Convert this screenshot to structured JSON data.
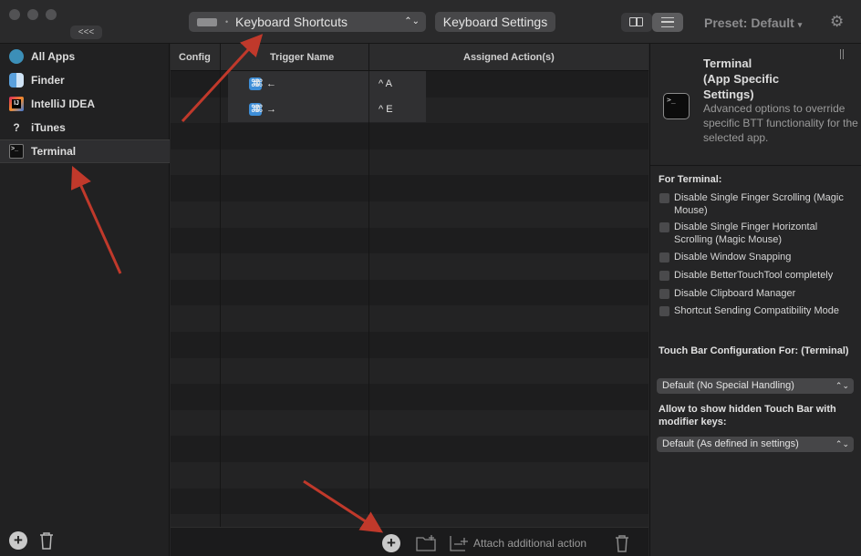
{
  "toolbar": {
    "collapse_label": "<<<",
    "category_label": "Keyboard Shortcuts",
    "settings_button": "Keyboard Settings",
    "preset_label": "Preset: Default"
  },
  "sidebar": {
    "items": [
      {
        "label": "All Apps",
        "icon": "globe-icon",
        "color": "#3c8fb8"
      },
      {
        "label": "Finder",
        "icon": "finder-icon",
        "color": "#5aa0dc"
      },
      {
        "label": "IntelliJ IDEA",
        "icon": "intellij-icon",
        "color": "#d6285c"
      },
      {
        "label": "iTunes",
        "icon": "question-icon",
        "color": "#d8d8d8"
      },
      {
        "label": "Terminal",
        "icon": "terminal-icon",
        "color": "#101010"
      }
    ]
  },
  "table": {
    "columns": [
      "Config",
      "Trigger Name",
      "Assigned Action(s)"
    ],
    "rows": [
      {
        "trigger": "⌘ ←",
        "action": "^ A"
      },
      {
        "trigger": "⌘ →",
        "action": "^ E"
      }
    ]
  },
  "footer": {
    "attach_label": "Attach additional action"
  },
  "panel": {
    "title": "Terminal\n(App Specific\nSettings)",
    "description": "Advanced options to override specific BTT functionality for the selected app.",
    "for_heading": "For Terminal:",
    "options": [
      "Disable Single Finger Scrolling (Magic Mouse)",
      "Disable Single Finger Horizontal Scrolling (Magic Mouse)",
      "Disable Window Snapping",
      "Disable BetterTouchTool completely",
      "Disable Clipboard Manager",
      "Shortcut Sending Compatibility Mode"
    ],
    "touchbar_heading": "Touch Bar Configuration For: (Terminal)",
    "touchbar_select": "Default (No Special Handling)",
    "hidden_heading": "Allow to show hidden Touch Bar with modifier keys:",
    "hidden_select": "Default (As defined in settings)"
  },
  "colors": {
    "arrow": "#c0392b",
    "accent": "#3e8ed8"
  }
}
